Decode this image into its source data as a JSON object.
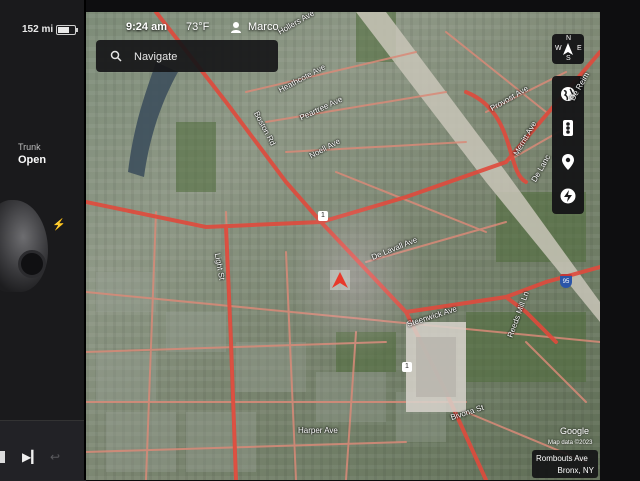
{
  "left_panel": {
    "range": "152 mi",
    "trunk_label": "Trunk",
    "trunk_status": "Open",
    "charging_icon": "lightning-bolt-icon"
  },
  "status_bar": {
    "time": "9:24 am",
    "temperature": "73°F",
    "user_icon": "person-icon",
    "user": "Marco"
  },
  "search": {
    "placeholder": "Navigate",
    "icon": "search-icon"
  },
  "map_controls": {
    "compass_letters": [
      "N",
      "E",
      "S",
      "W"
    ],
    "buttons": [
      "globe-icon",
      "traffic-light-icon",
      "location-pin-icon",
      "charging-bolt-icon"
    ]
  },
  "streets": {
    "heathcote": "Heathcote Ave",
    "peartree": "Peartree Ave",
    "noell": "Noell Ave",
    "boston": "Boston Rd",
    "provost": "Provost Ave",
    "merritt": "Merritt Ave",
    "delavall": "De Lavall Ave",
    "de_lancey": "De Lanc",
    "steenwick": "Steenwick Ave",
    "reeds_mill": "Reeds Mill Ln",
    "harper": "Harper Ave",
    "bivona": "Bivona St",
    "hollers": "Hollers Ave",
    "de_reimer": "De Reim",
    "light": "Light St"
  },
  "route_shields": [
    "1",
    "1",
    "95"
  ],
  "attribution": {
    "google": "Google",
    "map_data": "Map data ©2023"
  },
  "location": {
    "street": "Rombouts Ave",
    "city": "Bronx, NY"
  },
  "colors": {
    "road_major": "#e04a3c",
    "road_minor": "#d98a78",
    "nav_arrow": "#e8392b",
    "panel_bg": "#1a1a1c"
  }
}
